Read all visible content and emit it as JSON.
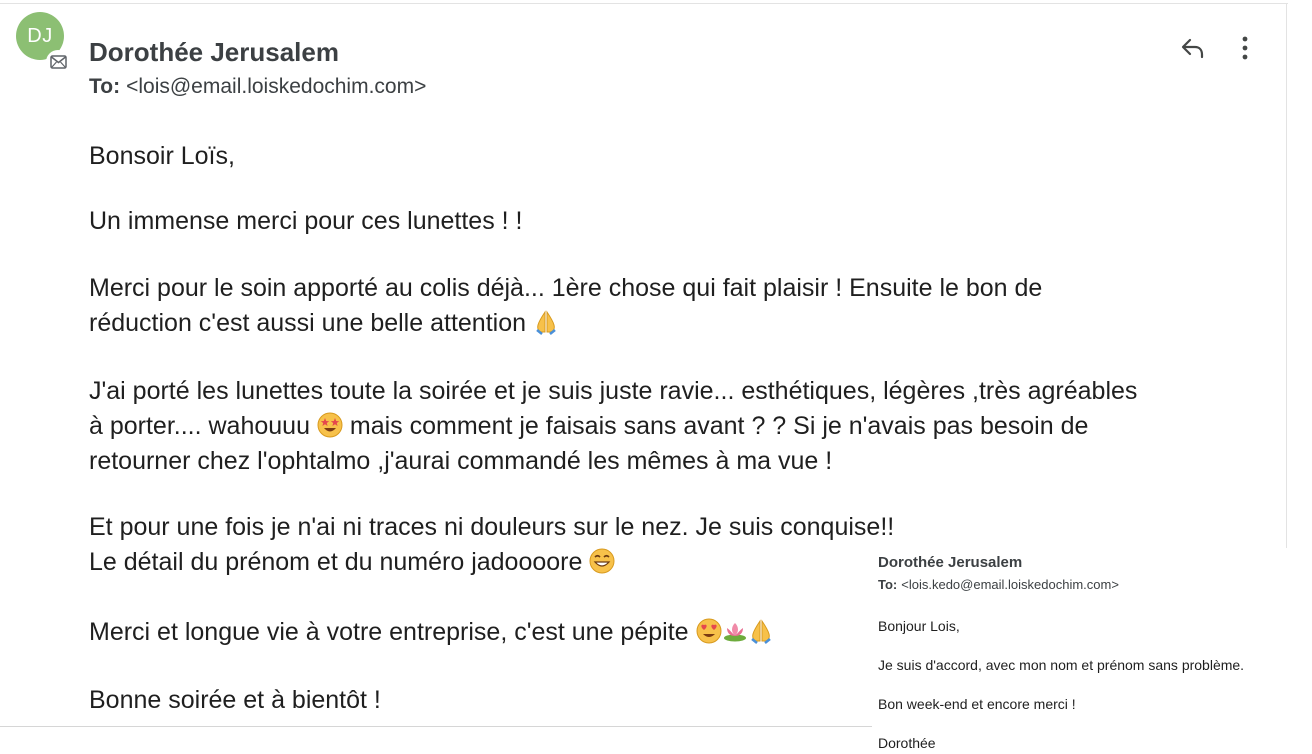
{
  "email": {
    "avatar_initials": "DJ",
    "sender_name": "Dorothée Jerusalem",
    "to_label": "To:",
    "to_address": "<lois@email.loiskedochim.com>",
    "actions": {
      "reply_icon": "reply-icon",
      "more_icon": "more-vertical-icon"
    },
    "body": {
      "greeting": "Bonsoir Loïs,",
      "p1": "Un immense merci pour ces lunettes ! !",
      "p2_line1": "Merci pour le soin apporté au colis déjà... 1ère chose qui fait plaisir ! Ensuite le bon de",
      "p2_line2": "réduction c'est aussi une belle attention",
      "p3_line1": "J'ai porté les lunettes toute la soirée et je suis juste ravie... esthétiques, légères ,très agréables",
      "p3_line2a": "à porter.... wahouuu",
      "p3_line2b": "mais comment je faisais sans avant ? ? Si je n'avais pas besoin de",
      "p3_line3": "retourner chez l'ophtalmo ,j'aurai commandé les mêmes à ma vue !",
      "p4_line1": "Et pour une fois je n'ai ni traces ni douleurs sur le nez. Je suis conquise!!",
      "p4_line2": "Le détail du prénom et du numéro jadoooore",
      "p5": "Merci et longue vie à votre entreprise, c'est une pépite",
      "p6": "Bonne soirée et à bientôt !"
    }
  },
  "overlay_email": {
    "sender_name": "Dorothée Jerusalem",
    "to_label": "To:",
    "to_address": "<lois.kedo@email.loiskedochim.com>",
    "greeting": "Bonjour Lois,",
    "line1": "Je suis d'accord, avec mon nom et prénom sans problème.",
    "line2": "Bon week-end et encore merci !",
    "signature": "Dorothée"
  },
  "colors": {
    "avatar_bg": "#8cbf73",
    "text": "#1f1f1f",
    "header_text": "#3c4043"
  }
}
